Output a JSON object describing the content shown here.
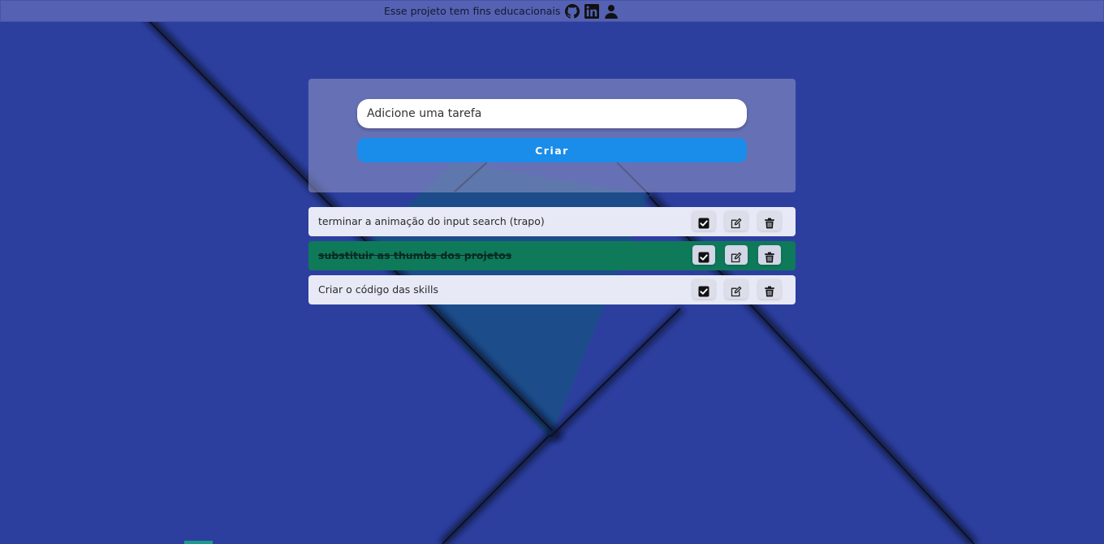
{
  "header": {
    "notice": "Esse projeto tem fins educacionais",
    "icons": [
      "github-icon",
      "linkedin-icon",
      "user-icon"
    ]
  },
  "form": {
    "input_placeholder": "Adicione uma tarefa",
    "input_value": "",
    "create_label": "Criar"
  },
  "tasks": [
    {
      "text": "terminar a animação do input search (trapo)",
      "done": false
    },
    {
      "text": "substituir as thumbs dos projetos",
      "done": true
    },
    {
      "text": "Criar o código das skills",
      "done": false
    }
  ],
  "colors": {
    "background": "#2d3f9e",
    "topbar": "#5562b3",
    "accent_button": "#1a8cea",
    "task_done": "#0e7a5a",
    "task_default": "#e7eaf6"
  }
}
